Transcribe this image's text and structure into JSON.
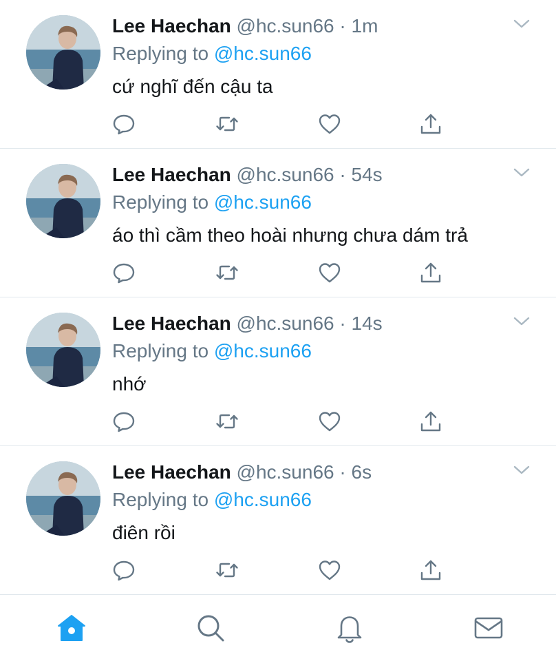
{
  "colors": {
    "text": "#14171a",
    "secondary": "#657786",
    "accent": "#1da1f2",
    "divider": "#e1e8ed"
  },
  "tweets": [
    {
      "name": "Lee Haechan",
      "handle": "@hc.sun66",
      "dot": "·",
      "time": "1m",
      "replying_prefix": "Replying to",
      "replying_handle": "@hc.sun66",
      "text": "cứ nghĩ đến cậu ta"
    },
    {
      "name": "Lee Haechan",
      "handle": "@hc.sun66",
      "dot": "·",
      "time": "54s",
      "replying_prefix": "Replying to",
      "replying_handle": "@hc.sun66",
      "text": "áo thì cầm theo hoài nhưng chưa dám trả"
    },
    {
      "name": "Lee Haechan",
      "handle": "@hc.sun66",
      "dot": "·",
      "time": "14s",
      "replying_prefix": "Replying to",
      "replying_handle": "@hc.sun66",
      "text": "nhớ"
    },
    {
      "name": "Lee Haechan",
      "handle": "@hc.sun66",
      "dot": "·",
      "time": "6s",
      "replying_prefix": "Replying to",
      "replying_handle": "@hc.sun66",
      "text": "điên rồi"
    }
  ],
  "icons": {
    "reply": "reply-icon",
    "retweet": "retweet-icon",
    "like": "heart-icon",
    "share": "share-icon",
    "more": "chevron-down-icon"
  },
  "tabbar": {
    "items": [
      {
        "id": "home",
        "icon": "home-icon",
        "active": true
      },
      {
        "id": "search",
        "icon": "search-icon",
        "active": false
      },
      {
        "id": "notifications",
        "icon": "bell-icon",
        "active": false
      },
      {
        "id": "messages",
        "icon": "mail-icon",
        "active": false
      }
    ]
  }
}
